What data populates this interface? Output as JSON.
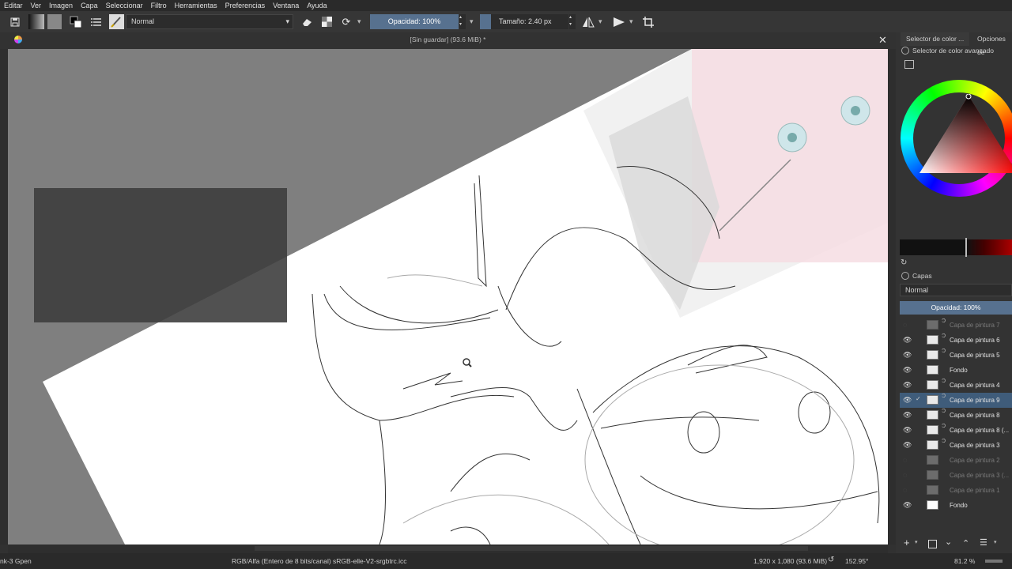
{
  "menu": [
    "Editar",
    "Ver",
    "Imagen",
    "Capa",
    "Seleccionar",
    "Filtro",
    "Herramientas",
    "Preferencias",
    "Ventana",
    "Ayuda"
  ],
  "toolbar": {
    "blend_mode": "Normal",
    "opacity_label": "Opacidad: 100%",
    "opacity_value": 1.0,
    "size_label": "Tamaño: 2.40 px"
  },
  "document": {
    "title": "[Sin guardar]  (93.6 MiB) *"
  },
  "docker": {
    "tabs": [
      "Selector de color ...",
      "Opciones de"
    ],
    "color_selector_title": "Selector de color avanzado",
    "layers_title": "Capas",
    "layers_blend": "Normal",
    "layers_opacity": "Opacidad:  100%",
    "layers": [
      {
        "name": "Capa de pintura 7",
        "visible": false,
        "selected": false
      },
      {
        "name": "Capa de pintura 6",
        "visible": true,
        "selected": false
      },
      {
        "name": "Capa de pintura 5",
        "visible": true,
        "selected": false
      },
      {
        "name": "Fondo",
        "visible": true,
        "selected": false
      },
      {
        "name": "Capa de pintura 4",
        "visible": true,
        "selected": false
      },
      {
        "name": "Capa de pintura 9",
        "visible": true,
        "selected": true
      },
      {
        "name": "Capa de pintura 8",
        "visible": true,
        "selected": false
      },
      {
        "name": "Capa de pintura 8 (...",
        "visible": true,
        "selected": false
      },
      {
        "name": "Capa de pintura 3",
        "visible": true,
        "selected": false
      },
      {
        "name": "Capa de pintura 2",
        "visible": false,
        "selected": false
      },
      {
        "name": "Capa de pintura 3 (...",
        "visible": false,
        "selected": false
      },
      {
        "name": "Capa de pintura 1",
        "visible": false,
        "selected": false
      },
      {
        "name": "Fondo",
        "visible": true,
        "selected": false
      }
    ]
  },
  "status": {
    "brush": "nk-3 Gpen",
    "color_profile": "RGB/Alfa (Entero de 8 bits/canal)  sRGB-elle-V2-srgbtrc.icc",
    "dimensions": "1,920 x 1,080 (93.6 MiB)",
    "rotation": "152.95°",
    "zoom": "81.2 %"
  },
  "icons": [
    "save-icon",
    "gradient-icon",
    "pattern-icon",
    "color-swap-icon",
    "brush-presets-icon",
    "brush-tip-icon",
    "eraser-icon",
    "alpha-lock-icon",
    "reload-icon",
    "mirror-horizontal-icon",
    "mirror-vertical-icon",
    "wrap-icon",
    "close-icon",
    "zoom-cursor-icon"
  ],
  "colors": {
    "selected_layer": "#3f5c7a",
    "opacity_slider": "#57718f",
    "canvas_bg": "#7f7f7f"
  }
}
